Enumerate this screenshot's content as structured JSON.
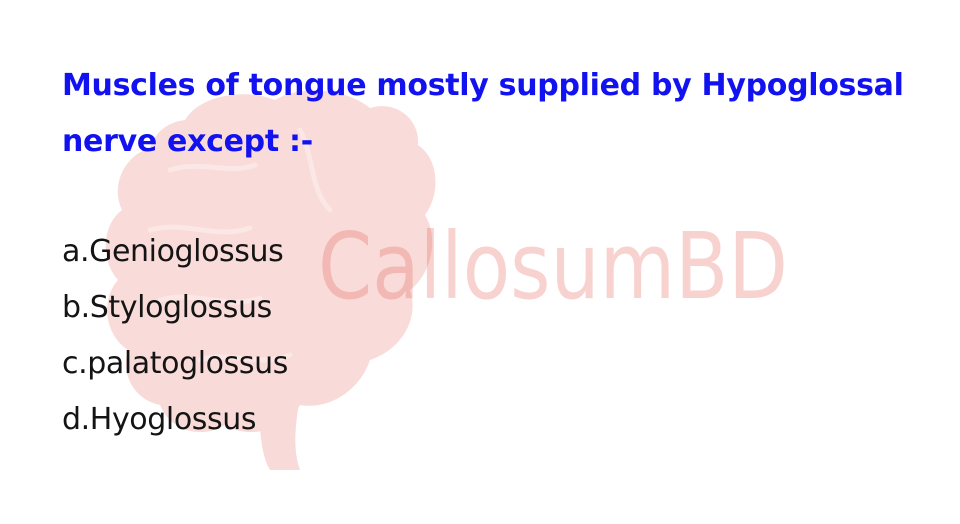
{
  "watermark": {
    "brand_text": "CallosumBD",
    "color": "#e25c52"
  },
  "question": {
    "text": "Muscles of tongue mostly supplied by Hypoglossal nerve except :-",
    "color": "#1212f0"
  },
  "options": [
    {
      "text": "a.Genioglossus"
    },
    {
      "text": "b.Styloglossus"
    },
    {
      "text": "c.palatoglossus"
    },
    {
      "text": "d.Hyoglossus"
    }
  ]
}
